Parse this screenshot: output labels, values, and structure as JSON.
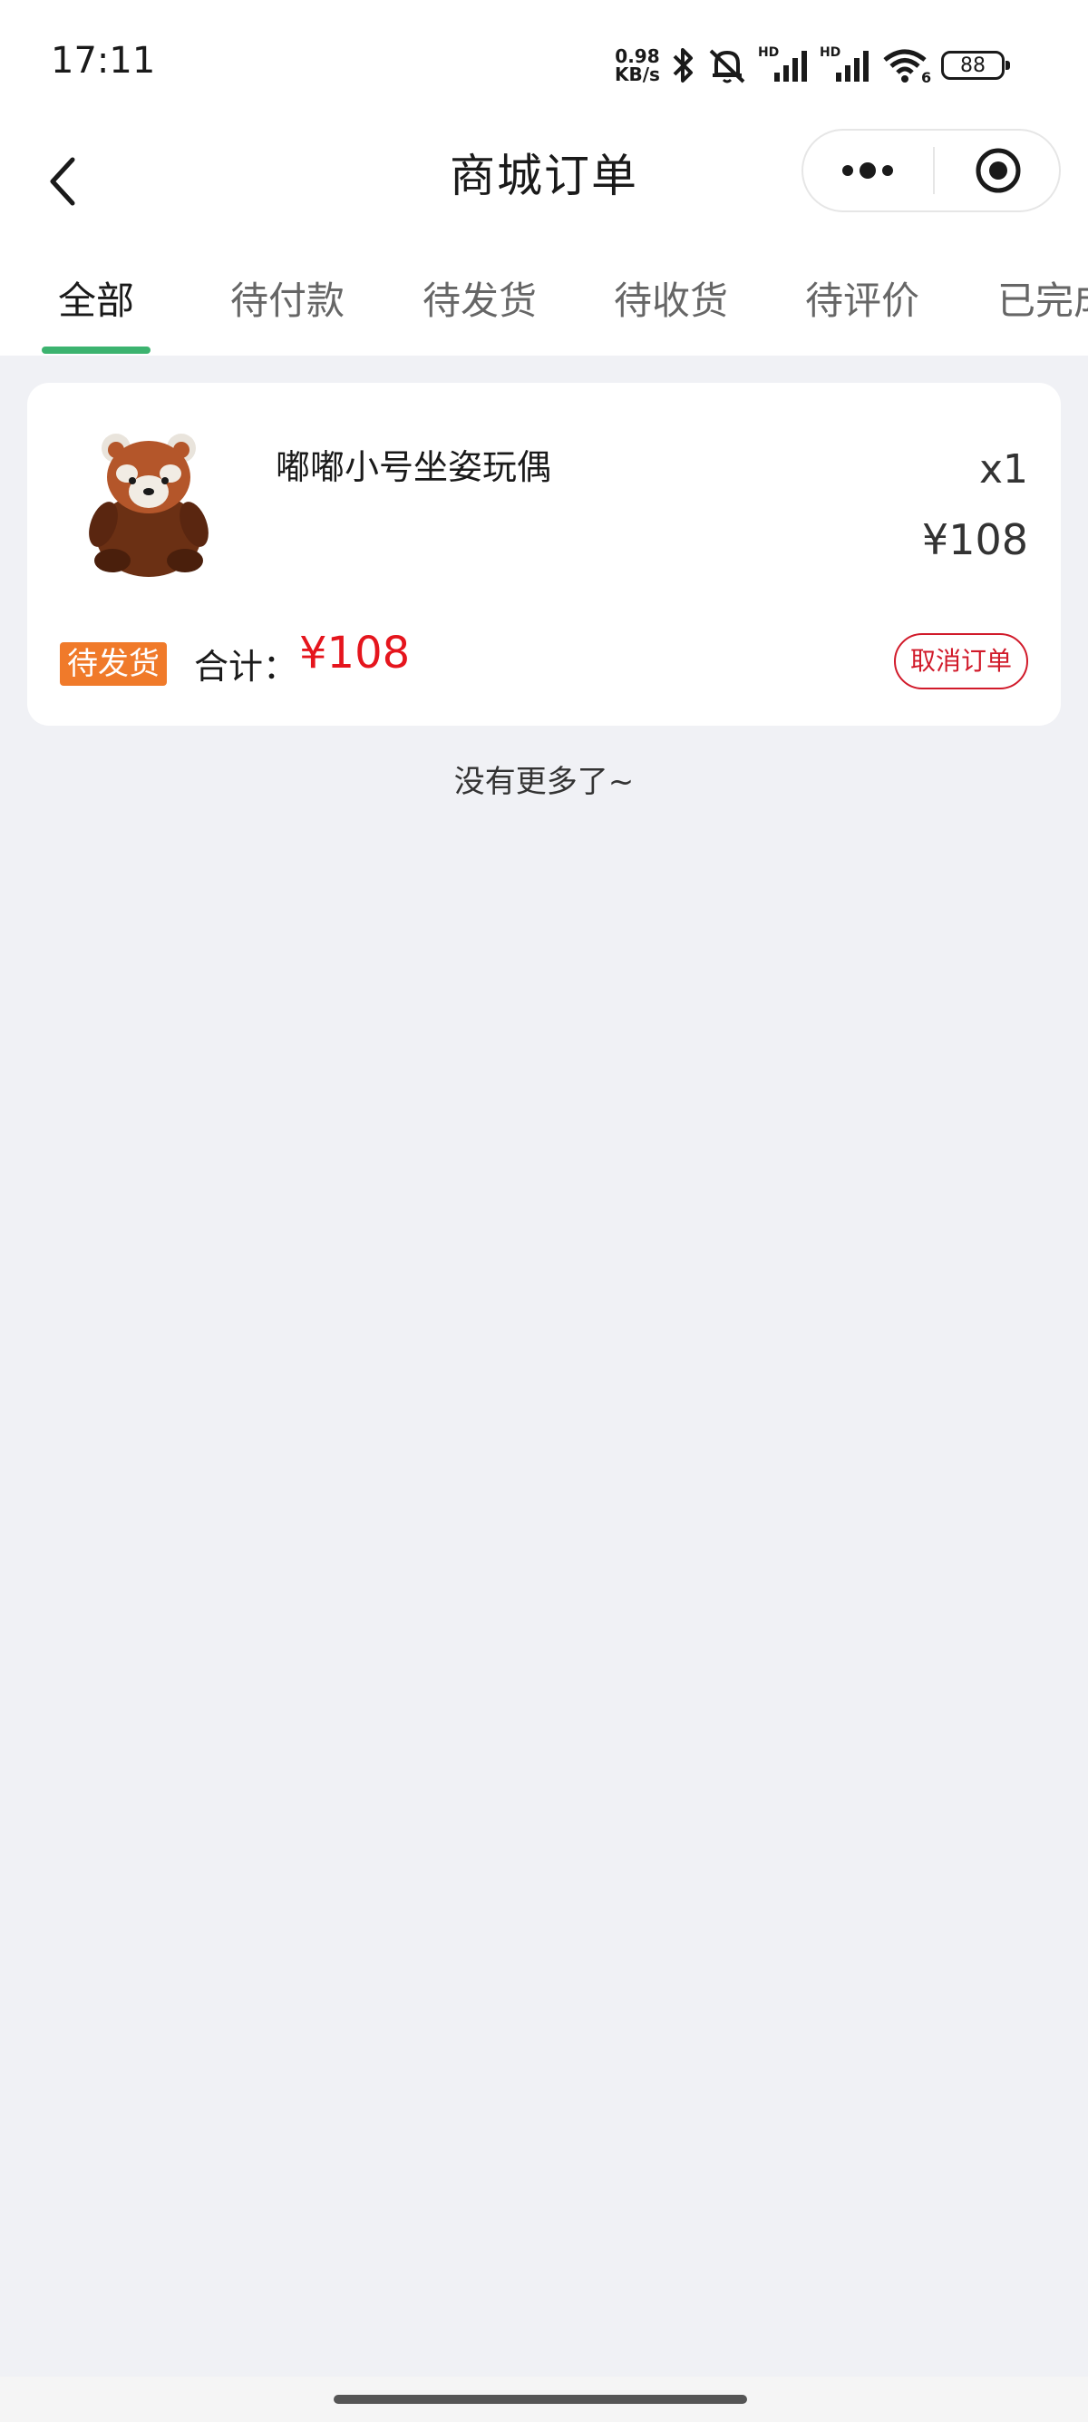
{
  "status_bar": {
    "time": "17:11",
    "net_speed_value": "0.98",
    "net_speed_unit": "KB/s",
    "battery": "88",
    "signal_label_1": "HD",
    "signal_label_2": "HD",
    "wifi_label": "6"
  },
  "nav": {
    "title": "商城订单",
    "back_icon": "chevron-left-icon",
    "more_icon": "more-dots-icon",
    "close_icon": "target-circle-icon"
  },
  "tabs": [
    {
      "label": "全部",
      "active": true
    },
    {
      "label": "待付款",
      "active": false
    },
    {
      "label": "待发货",
      "active": false
    },
    {
      "label": "待收货",
      "active": false
    },
    {
      "label": "待评价",
      "active": false
    },
    {
      "label": "已完成",
      "active": false
    }
  ],
  "orders": [
    {
      "product_name": "嘟嘟小号坐姿玩偶",
      "quantity": "x1",
      "price": "¥108",
      "status": "待发货",
      "total_label": "合计：",
      "total_value": "¥108",
      "action": "取消订单"
    }
  ],
  "footer_text": "没有更多了~",
  "colors": {
    "accent": "#3cb36f",
    "price": "#e5151d",
    "badge": "#f07a2a",
    "cancel": "#d11a2a",
    "background": "#f0f1f5"
  }
}
